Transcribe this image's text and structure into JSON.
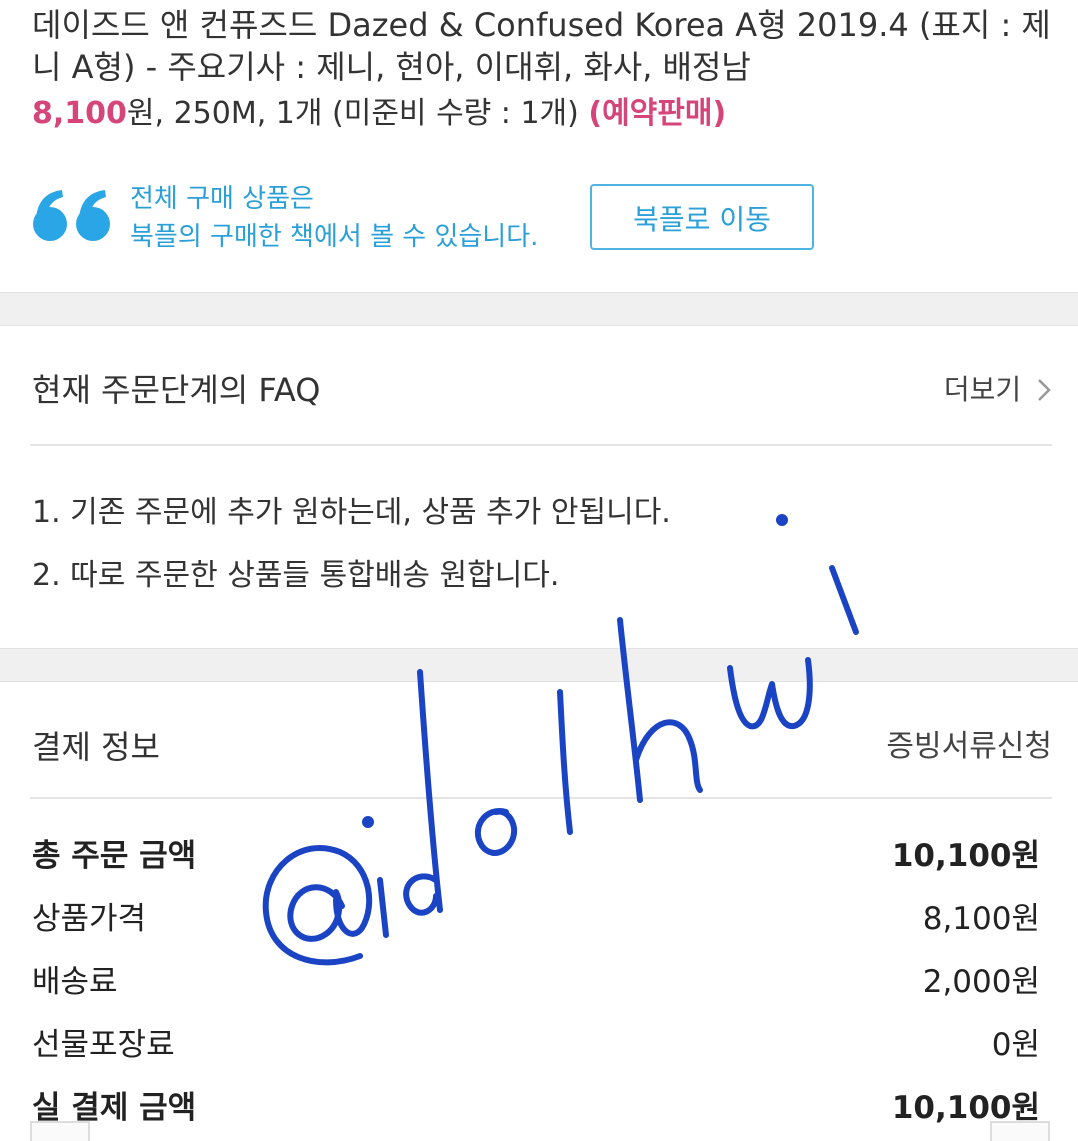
{
  "product": {
    "title": "데이즈드 앤 컨퓨즈드 Dazed & Confused Korea A형 2019.4 (표지 : 제니 A형) - 주요기사 : 제니, 현아, 이대휘, 화사, 배정남",
    "price": "8,100",
    "price_unit": "원",
    "details": ", 250M, 1개 (미준비 수량 : 1개) ",
    "status": "(예약판매)"
  },
  "notice": {
    "line1": "전체 구매 상품은",
    "line2": "북플의 구매한 책에서 볼 수 있습니다.",
    "button_label": "북플로 이동",
    "icon": "quote-icon"
  },
  "faq": {
    "title": "현재 주문단계의 FAQ",
    "more_label": "더보기",
    "items": [
      "1. 기존 주문에 추가 원하는데, 상품 추가 안됩니다.",
      "2. 따로 주문한 상품들 통합배송 원합니다."
    ]
  },
  "payment": {
    "title": "결제 정보",
    "receipt_label": "증빙서류신청",
    "rows": [
      {
        "label": "총 주문 금액",
        "value": "10,100원"
      },
      {
        "label": "상품가격",
        "value": "8,100원"
      },
      {
        "label": "배송료",
        "value": "2,000원"
      },
      {
        "label": "선물포장료",
        "value": "0원"
      },
      {
        "label": "실 결제 금액",
        "value": "10,100원"
      }
    ]
  },
  "watermark": {
    "text": "@idolhwi"
  },
  "colors": {
    "accent_pink": "#d6457a",
    "accent_blue": "#2a9fd8",
    "watermark_blue": "#1a44c4"
  }
}
